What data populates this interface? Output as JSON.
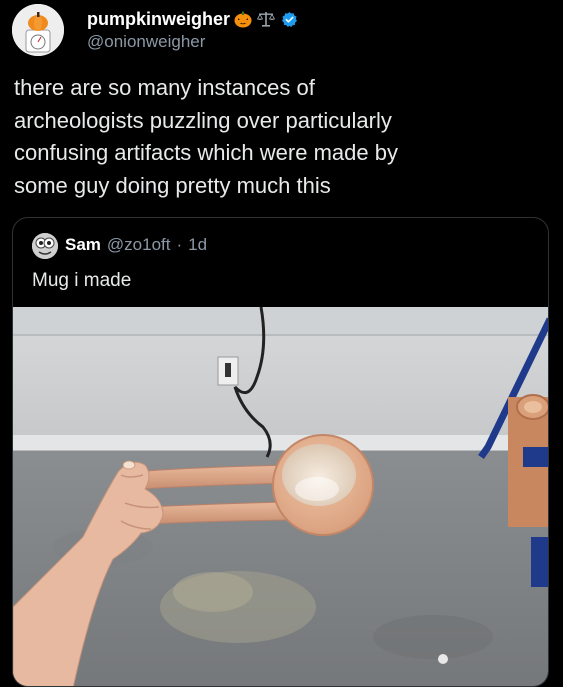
{
  "tweet": {
    "display_name": "pumpkinweigher",
    "handle": "@onionweigher",
    "name_emojis": [
      "jack-o-lantern-emoji",
      "balance-scale-emoji"
    ],
    "verified_badge_color": "#1d9bf0",
    "text_lines": [
      "there are so many instances of",
      "archeologists puzzling over particularly",
      "confusing artifacts which were made by",
      "some guy doing pretty much this"
    ]
  },
  "quote": {
    "display_name": "Sam",
    "handle": "@zo1oft",
    "separator": "·",
    "time": "1d",
    "text": "Mug i made",
    "media_description_icon": "photo-ceramic-mug-with-long-handle"
  },
  "colors": {
    "background": "#000000",
    "text_primary": "#e7e9ea",
    "text_secondary": "#8b98a5",
    "border": "#2f3336",
    "accent": "#1d9bf0"
  }
}
